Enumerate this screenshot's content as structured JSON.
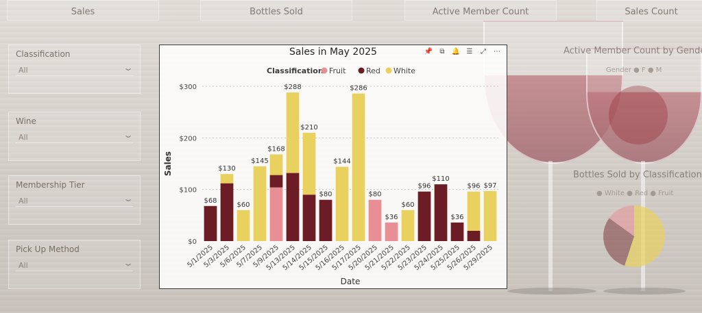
{
  "kpis": [
    "Sales",
    "Bottles Sold",
    "Active Member Count",
    "Sales Count"
  ],
  "slicers": [
    {
      "label": "Classification",
      "value": "All"
    },
    {
      "label": "Wine",
      "value": "All"
    },
    {
      "label": "Membership Tier",
      "value": "All"
    },
    {
      "label": "Pick Up Method",
      "value": "All"
    }
  ],
  "side_visuals": {
    "member_title": "Active Member Count by Gender",
    "member_legend": "Gender ● F ● M",
    "bottles_title": "Bottles Sold by Classification",
    "bottles_legend": "● White ● Red ● Fruit"
  },
  "toolbar_icons": [
    "pin-icon",
    "copy-icon",
    "alert-icon",
    "filter-icon",
    "focus-mode-icon",
    "more-options-icon"
  ],
  "chart_data": {
    "type": "bar",
    "stacked": true,
    "title": "Sales in May 2025",
    "xlabel": "Date",
    "ylabel": "Sales",
    "ylim": [
      0,
      300
    ],
    "yticks": [
      "$0",
      "$100",
      "$200",
      "$300"
    ],
    "legend_title": "Classification",
    "legend_position": "top",
    "grid": true,
    "colors": {
      "Fruit": "#e88f96",
      "Red": "#6b1c24",
      "White": "#e8d15f"
    },
    "categories": [
      "5/1/2025",
      "5/3/2025",
      "5/6/2025",
      "5/7/2025",
      "5/9/2025",
      "5/13/2025",
      "5/14/2025",
      "5/15/2025",
      "5/16/2025",
      "5/17/2025",
      "5/20/2025",
      "5/21/2025",
      "5/22/2025",
      "5/23/2025",
      "5/24/2025",
      "5/25/2025",
      "5/26/2025",
      "5/29/2025"
    ],
    "series": [
      {
        "name": "Fruit",
        "values": [
          0,
          0,
          0,
          0,
          104,
          0,
          0,
          0,
          0,
          0,
          80,
          36,
          0,
          0,
          0,
          0,
          0,
          0
        ]
      },
      {
        "name": "Red",
        "values": [
          68,
          112,
          0,
          0,
          24,
          132,
          90,
          80,
          0,
          0,
          0,
          0,
          0,
          96,
          110,
          36,
          20,
          0
        ]
      },
      {
        "name": "White",
        "values": [
          0,
          18,
          60,
          145,
          40,
          156,
          120,
          0,
          144,
          286,
          0,
          0,
          60,
          0,
          0,
          0,
          76,
          97
        ]
      }
    ],
    "total_labels": [
      "$68",
      "$130",
      "$60",
      "$145",
      "$168",
      "$288",
      "$210",
      "$80",
      "$144",
      "$286",
      "$80",
      "$36",
      "$60",
      "$96",
      "$110",
      "$36",
      "$96",
      "$97"
    ]
  }
}
